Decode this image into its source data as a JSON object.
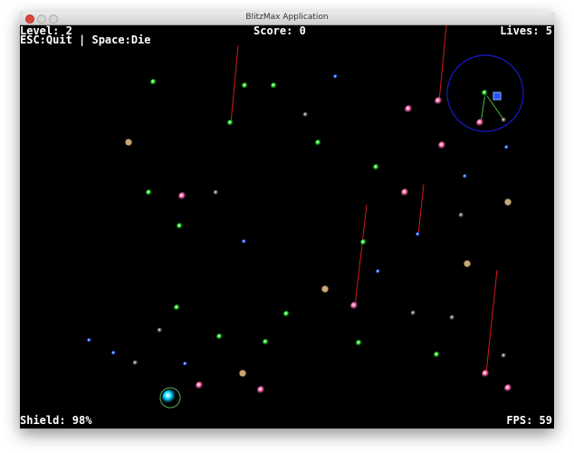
{
  "window": {
    "title": "BlitzMax Application"
  },
  "hud": {
    "level": "Level: 2",
    "controls": "ESC:Quit | Space:Die",
    "score": "Score: 0",
    "lives": "Lives: 5",
    "shield": "Shield: 98%",
    "fps": "FPS: 59"
  },
  "colors": {
    "green": "#22dd22",
    "blue": "#2266ff",
    "pink": "#ff5fa8",
    "gray": "#6e6a5c",
    "tan": "#c8a878",
    "player": "#00d8ff",
    "trail": "#d11a1a",
    "radar": "#1a1acc"
  }
}
